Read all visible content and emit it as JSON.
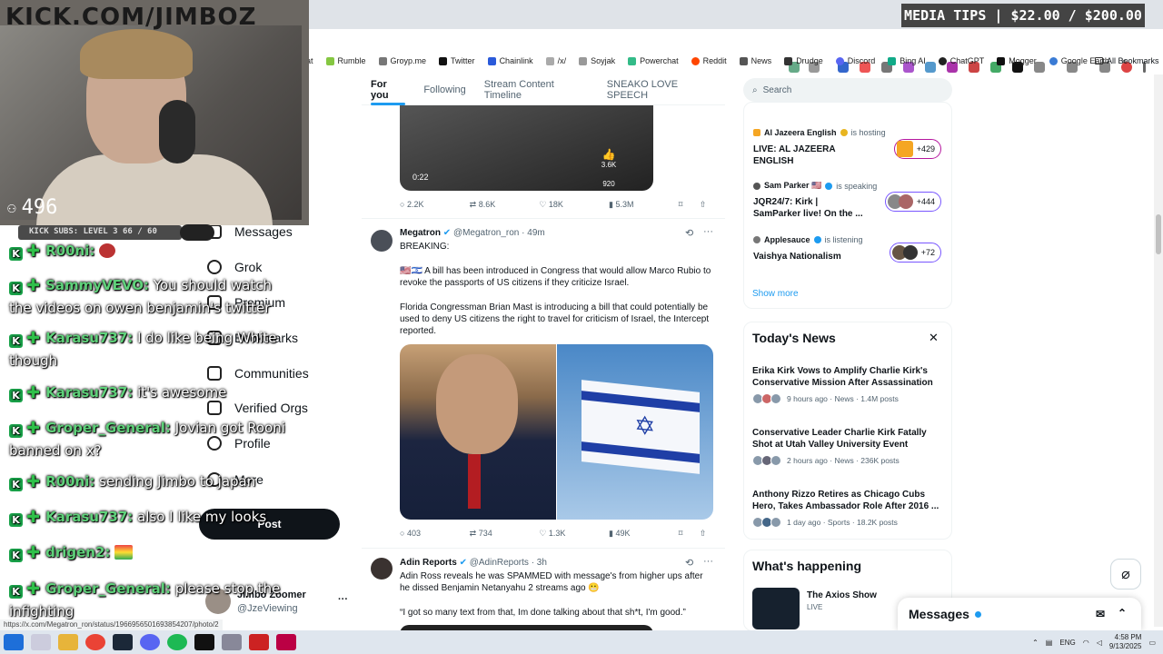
{
  "overlay": {
    "channel_text": "KICK.COM/JIMBOZ",
    "viewer_count": "496",
    "subs_text": "KICK SUBS: LEVEL 3 66 / 60",
    "media_tips": "MEDIA TIPS | $22.00 / $200.00"
  },
  "bookmarks": [
    "Rumble",
    "Groyp.me",
    "Twitter",
    "Chainlink",
    "/x/",
    "Soyjak",
    "Powerchat",
    "Reddit",
    "News",
    "Drudge",
    "Discord",
    "Bing AI",
    "ChatGPT",
    "Mogger",
    "Google Earth"
  ],
  "all_bookmarks": "All Bookmarks",
  "x_nav": {
    "messages": "Messages",
    "grok": "Grok",
    "premium": "Premium",
    "bookmarks": "Bookmarks",
    "communities": "Communities",
    "verified_orgs": "Verified Orgs",
    "profile": "Profile",
    "more": "More",
    "post": "Post",
    "user_name": "Jimbo Zoomer",
    "user_handle": "@JzeViewing"
  },
  "chat": [
    {
      "user": "R00ni:",
      "text": ""
    },
    {
      "user": "SammyVEVO:",
      "text": "You should watch the videos on owen benjamin's twitter"
    },
    {
      "user": "Karasu737:",
      "text": "I do like being White though"
    },
    {
      "user": "Karasu737:",
      "text": "it's awesome"
    },
    {
      "user": "Groper_General:",
      "text": "Jovian got Rooni banned on x?"
    },
    {
      "user": "R00ni:",
      "text": "sending Jimbo to japan"
    },
    {
      "user": "Karasu737:",
      "text": "also I like my looks"
    },
    {
      "user": "drigen2:",
      "text": ""
    },
    {
      "user": "Groper_General:",
      "text": "please stop the infighting"
    }
  ],
  "tabs": [
    "For you",
    "Following",
    "Stream Content Timeline",
    "SNEAKO LOVE SPEECH"
  ],
  "video": {
    "time": "0:22",
    "likes": "3.6K",
    "comments": "920"
  },
  "actions1": [
    "2.2K",
    "8.6K",
    "18K",
    "5.3M"
  ],
  "tweet1": {
    "name": "Megatron",
    "handle": "@Megatron_ron",
    "age": "· 49m",
    "line1": "BREAKING:",
    "line2": "🇺🇸🇮🇱 A bill has been introduced in Congress that would allow Marco Rubio to revoke the passports of US citizens if they criticize Israel.",
    "line3": "Florida Congressman Brian Mast is introducing a bill that could potentially be used to deny US citizens the right to travel for criticism of Israel, the Intercept reported."
  },
  "actions2": [
    "403",
    "734",
    "1.3K",
    "49K"
  ],
  "tweet2": {
    "name": "Adin Reports",
    "handle": "@AdinReports",
    "age": "· 3h",
    "line1": "Adin Ross reveals he was SPAMMED with message's from higher ups after he dissed Benjamin Netanyahu 2 streams ago 😬",
    "line2": "“I got so many text from that, Im done talking about that sh*t, I'm good.”"
  },
  "search_placeholder": "Search",
  "spaces": [
    {
      "host": "Al Jazeera English",
      "status": "is hosting",
      "title": "LIVE: AL JAZEERA ENGLISH",
      "count": "+429"
    },
    {
      "host": "Sam Parker 🇺🇸",
      "status": "is speaking",
      "title": "JQR24/7: Kirk | SamParker live! On the ...",
      "count": "+444"
    },
    {
      "host": "Applesauce",
      "status": "is listening",
      "title": "Vaishya Nationalism",
      "count": "+72"
    }
  ],
  "show_more": "Show more",
  "news_title": "Today's News",
  "news": [
    {
      "headline": "Erika Kirk Vows to Amplify Charlie Kirk's Conservative Mission After Assassination",
      "meta": "9 hours ago · News · 1.4M posts"
    },
    {
      "headline": "Conservative Leader Charlie Kirk Fatally Shot at Utah Valley University Event",
      "meta": "2 hours ago · News · 236K posts"
    },
    {
      "headline": "Anthony Rizzo Retires as Chicago Cubs Hero, Takes Ambassador Role After 2016 ...",
      "meta": "1 day ago · Sports · 18.2K posts"
    }
  ],
  "happening_title": "What's happening",
  "happening": {
    "name": "The Axios Show",
    "status": "LIVE"
  },
  "messages_dock": "Messages",
  "status_url": "https://x.com/Megatron_ron/status/1966956501693854207/photo/2",
  "clock": {
    "time": "4:58 PM",
    "date": "9/13/2025",
    "lang": "ENG"
  }
}
